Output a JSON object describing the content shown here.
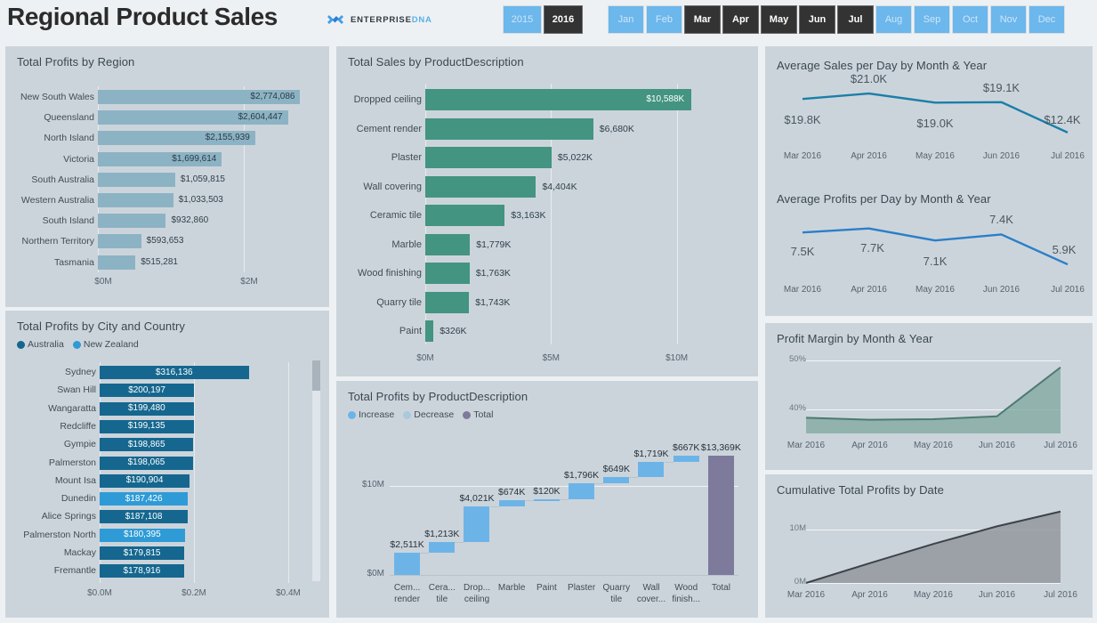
{
  "header": {
    "title": "Regional Product Sales",
    "brand": {
      "name": "ENTERPRISE",
      "suffix": "DNA"
    },
    "years": [
      {
        "label": "2015",
        "selected": false
      },
      {
        "label": "2016",
        "selected": true
      }
    ],
    "months": [
      {
        "label": "Jan",
        "selected": false
      },
      {
        "label": "Feb",
        "selected": false
      },
      {
        "label": "Mar",
        "selected": true
      },
      {
        "label": "Apr",
        "selected": true
      },
      {
        "label": "May",
        "selected": true
      },
      {
        "label": "Jun",
        "selected": true
      },
      {
        "label": "Jul",
        "selected": true
      },
      {
        "label": "Aug",
        "selected": false
      },
      {
        "label": "Sep",
        "selected": false
      },
      {
        "label": "Oct",
        "selected": false
      },
      {
        "label": "Nov",
        "selected": false
      },
      {
        "label": "Dec",
        "selected": false
      }
    ]
  },
  "colors": {
    "page_background": "#eef1f4",
    "panel_background": "#ccd4db",
    "slicer_unselected": "#6cb7ec",
    "slicer_selected": "#333333",
    "region_bar": "#8cb3c4",
    "product_bar": "#439480",
    "australia": "#15678f",
    "new_zealand": "#2e9bd6",
    "waterfall_increase": "#6cb4e8",
    "waterfall_decrease": "#a9c9de",
    "waterfall_total": "#7d7a9c",
    "line_sales": "#1a7fa8",
    "line_profits": "#2a7fc9",
    "area_margin": "#7ea79e",
    "area_cumulative": "#8f9499"
  },
  "chart_data": [
    {
      "id": "total-profits-by-region",
      "type": "bar",
      "orientation": "horizontal",
      "title": "Total Profits by Region",
      "xlabel": "",
      "ylabel": "",
      "xlim": [
        0,
        3000000
      ],
      "ticks": [
        "$0M",
        "$2M"
      ],
      "tick_values": [
        0,
        2000000
      ],
      "categories": [
        "New South Wales",
        "Queensland",
        "North Island",
        "Victoria",
        "South Australia",
        "Western Australia",
        "South Island",
        "Northern Territory",
        "Tasmania"
      ],
      "values": [
        2774086,
        2604447,
        2155939,
        1699614,
        1059815,
        1033503,
        932860,
        593653,
        515281
      ],
      "labels": [
        "$2,774,086",
        "$2,604,447",
        "$2,155,939",
        "$1,699,614",
        "$1,059,815",
        "$1,033,503",
        "$932,860",
        "$593,653",
        "$515,281"
      ]
    },
    {
      "id": "total-profits-by-city-and-country",
      "type": "bar",
      "orientation": "horizontal",
      "title": "Total Profits by City and Country",
      "legend": [
        "Australia",
        "New Zealand"
      ],
      "legend_position": "top-left",
      "xlim": [
        0,
        400000
      ],
      "ticks": [
        "$0.0M",
        "$0.2M",
        "$0.4M"
      ],
      "tick_values": [
        0,
        200000,
        400000
      ],
      "categories": [
        "Sydney",
        "Swan Hill",
        "Wangaratta",
        "Redcliffe",
        "Gympie",
        "Palmerston",
        "Mount Isa",
        "Dunedin",
        "Alice Springs",
        "Palmerston North",
        "Mackay",
        "Fremantle"
      ],
      "values": [
        316136,
        200197,
        199480,
        199135,
        198865,
        198065,
        190904,
        187426,
        187108,
        180395,
        179815,
        178916
      ],
      "labels": [
        "$316,136",
        "$200,197",
        "$199,480",
        "$199,135",
        "$198,865",
        "$198,065",
        "$190,904",
        "$187,426",
        "$187,108",
        "$180,395",
        "$179,815",
        "$178,916"
      ],
      "groups": [
        "Australia",
        "Australia",
        "Australia",
        "Australia",
        "Australia",
        "Australia",
        "Australia",
        "New Zealand",
        "Australia",
        "New Zealand",
        "Australia",
        "Australia"
      ]
    },
    {
      "id": "total-sales-by-productdescription",
      "type": "bar",
      "orientation": "horizontal",
      "title": "Total Sales by ProductDescription",
      "xlim": [
        0,
        11500000
      ],
      "ticks": [
        "$0M",
        "$5M",
        "$10M"
      ],
      "tick_values": [
        0,
        5000000,
        10000000
      ],
      "categories": [
        "Dropped ceiling",
        "Cement render",
        "Plaster",
        "Wall covering",
        "Ceramic tile",
        "Marble",
        "Wood finishing",
        "Quarry tile",
        "Paint"
      ],
      "values": [
        10588000,
        6680000,
        5022000,
        4404000,
        3163000,
        1779000,
        1763000,
        1743000,
        326000
      ],
      "labels": [
        "$10,588K",
        "$6,680K",
        "$5,022K",
        "$4,404K",
        "$3,163K",
        "$1,779K",
        "$1,763K",
        "$1,743K",
        "$326K"
      ]
    },
    {
      "id": "total-profits-by-productdescription",
      "type": "bar",
      "subtype": "waterfall",
      "title": "Total Profits by ProductDescription",
      "legend": [
        "Increase",
        "Decrease",
        "Total"
      ],
      "ylim": [
        0,
        14000000
      ],
      "yticks": [
        "$0M",
        "$10M"
      ],
      "ytick_values": [
        0,
        10000000
      ],
      "categories": [
        "Cem... render",
        "Cera... tile",
        "Drop... ceiling",
        "Marble",
        "Paint",
        "Plaster",
        "Quarry tile",
        "Wall cover...",
        "Wood finish...",
        "Total"
      ],
      "values": [
        2511000,
        1213000,
        4021000,
        674000,
        120000,
        1796000,
        649000,
        1719000,
        667000,
        13369000
      ],
      "labels": [
        "$2,511K",
        "$1,213K",
        "$4,021K",
        "$674K",
        "$120K",
        "$1,796K",
        "$649K",
        "$1,719K",
        "$667K",
        "$13,369K"
      ],
      "kinds": [
        "increase",
        "increase",
        "increase",
        "increase",
        "increase",
        "increase",
        "increase",
        "increase",
        "increase",
        "total"
      ],
      "cumulative_start": [
        0,
        2511000,
        3724000,
        7745000,
        8419000,
        8539000,
        10335000,
        10984000,
        12703000,
        0
      ]
    },
    {
      "id": "average-sales-per-day-by-month-year",
      "type": "line",
      "title": "Average Sales per Day by Month & Year",
      "categories": [
        "Mar 2016",
        "Apr 2016",
        "May 2016",
        "Jun 2016",
        "Jul 2016"
      ],
      "values": [
        19800,
        21000,
        19000,
        19100,
        12400
      ],
      "labels": [
        "$19.8K",
        "$21.0K",
        "$19.0K",
        "$19.1K",
        "$12.4K"
      ],
      "ylim": [
        11000,
        22000
      ],
      "grid": false
    },
    {
      "id": "average-profits-per-day-by-month-year",
      "type": "line",
      "title": "Average Profits per Day by Month & Year",
      "categories": [
        "Mar 2016",
        "Apr 2016",
        "May 2016",
        "Jun 2016",
        "Jul 2016"
      ],
      "values": [
        7500,
        7700,
        7100,
        7400,
        5900
      ],
      "labels": [
        "7.5K",
        "7.7K",
        "7.1K",
        "7.4K",
        "5.9K"
      ],
      "ylim": [
        5500,
        8000
      ],
      "grid": false
    },
    {
      "id": "profit-margin-by-month-year",
      "type": "area",
      "title": "Profit Margin by Month & Year",
      "categories": [
        "Mar 2016",
        "Apr 2016",
        "May 2016",
        "Jun 2016",
        "Jul 2016"
      ],
      "values": [
        38.2,
        37.8,
        37.9,
        38.5,
        48.5
      ],
      "ylim": [
        35,
        51
      ],
      "yticks": [
        "40%",
        "50%"
      ],
      "ytick_values": [
        40,
        50
      ],
      "grid": true
    },
    {
      "id": "cumulative-total-profits-by-date",
      "type": "area",
      "title": "Cumulative Total Profits by Date",
      "categories": [
        "Mar 2016",
        "Apr 2016",
        "May 2016",
        "Jun 2016",
        "Jul 2016"
      ],
      "values": [
        0,
        3700000,
        7300000,
        10600000,
        13369000
      ],
      "ylim": [
        0,
        15000000
      ],
      "yticks": [
        "0M",
        "10M"
      ],
      "ytick_values": [
        0,
        10000000
      ],
      "grid": true
    }
  ]
}
